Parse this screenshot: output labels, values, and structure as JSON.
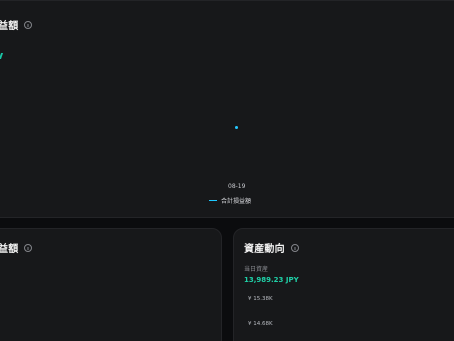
{
  "top_card": {
    "title": "益額",
    "date": "08-19",
    "legend": "合計損益額"
  },
  "bottom_left_card": {
    "title": "益額"
  },
  "bottom_right_card": {
    "title": "資産動向",
    "today_label": "当日資産",
    "today_value": "13,989.23 JPY",
    "axis_labels": [
      "¥ 15.38K",
      "¥ 14.68K"
    ]
  },
  "colors": {
    "accent_green": "#1fd1a8",
    "accent_blue": "#25c8ff"
  },
  "icons": [
    "info-icon"
  ]
}
